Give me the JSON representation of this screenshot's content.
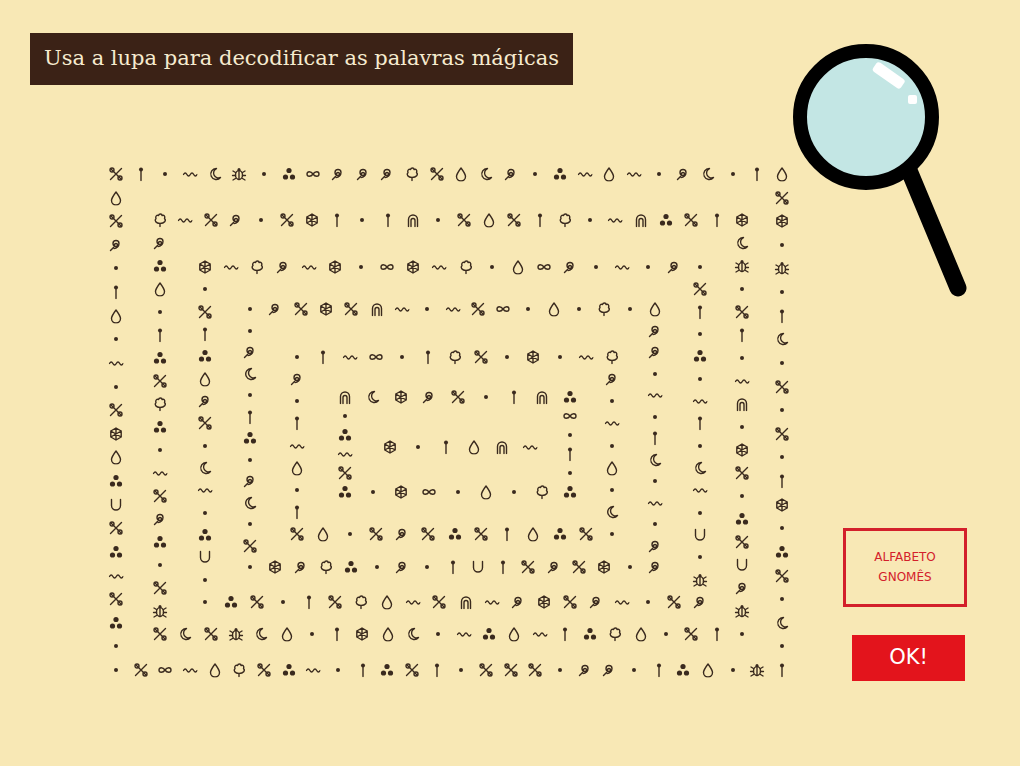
{
  "title": "Usa a lupa para decodificar as palavras mágicas",
  "spiral": {
    "rings": [
      {
        "top": [
          "bow",
          "bar",
          "dot",
          "wave",
          "moon",
          "bug",
          "dot",
          "tri",
          "knot",
          "swirl",
          "swirl",
          "swirl",
          "leaf",
          "bow",
          "drop",
          "moon",
          "swirl",
          "dot",
          "tri",
          "wave",
          "drop",
          "wave",
          "dot",
          "swirl",
          "moon",
          "dot",
          "bar",
          "drop"
        ],
        "right": [
          "bow",
          "hex",
          "dot",
          "bug",
          "dot",
          "bar",
          "moon",
          "dot",
          "bow",
          "dot",
          "bow",
          "dot",
          "bar",
          "hex",
          "dot",
          "tri",
          "bow",
          "dot",
          "moon",
          "dot"
        ],
        "bottom": [
          "dot",
          "bow",
          "knot",
          "wave",
          "drop",
          "leaf",
          "bow",
          "tri",
          "wave",
          "dot",
          "bar",
          "tri",
          "bow",
          "bar",
          "dot",
          "bow",
          "bow",
          "bow",
          "dot",
          "swirl",
          "swirl",
          "dot",
          "bar",
          "tri",
          "drop",
          "dot",
          "bug",
          "bar"
        ],
        "left": [
          "drop",
          "bow",
          "swirl",
          "dot",
          "bar",
          "drop",
          "dot",
          "wave",
          "dot",
          "bow",
          "hex",
          "drop",
          "tri",
          "cup",
          "bow",
          "tri",
          "wave",
          "bow",
          "tri",
          "dot"
        ]
      },
      {
        "top": [
          "leaf",
          "wave",
          "bow",
          "swirl",
          "dot",
          "bow",
          "hex",
          "bar",
          "dot",
          "bar",
          "arch",
          "dot",
          "bow",
          "drop",
          "bow",
          "bar",
          "leaf",
          "dot",
          "wave",
          "arch",
          "tri",
          "bow",
          "bar",
          "hex"
        ],
        "right": [
          "moon",
          "bug",
          "dot",
          "bow",
          "bar",
          "dot",
          "wave",
          "arch",
          "dot",
          "hex",
          "bow",
          "dot",
          "tri",
          "bow",
          "cup",
          "swirl",
          "bug"
        ],
        "bottom": [
          "bow",
          "moon",
          "bow",
          "bug",
          "moon",
          "drop",
          "dot",
          "bar",
          "hex",
          "drop",
          "moon",
          "dot",
          "wave",
          "tri",
          "drop",
          "wave",
          "bar",
          "tri",
          "leaf",
          "drop",
          "dot",
          "bow",
          "bar",
          "dot"
        ],
        "left": [
          "swirl",
          "tri",
          "drop",
          "dot",
          "bar",
          "tri",
          "bow",
          "leaf",
          "tri",
          "dot",
          "wave",
          "bow",
          "swirl",
          "tri",
          "dot",
          "bow",
          "bug"
        ]
      },
      {
        "top": [
          "hex",
          "wave",
          "leaf",
          "swirl",
          "wave",
          "hex",
          "dot",
          "knot",
          "hex",
          "wave",
          "leaf",
          "dot",
          "drop",
          "knot",
          "swirl",
          "dot",
          "wave",
          "dot",
          "swirl",
          "dot"
        ],
        "right": [
          "bow",
          "bar",
          "dot",
          "tri",
          "dot",
          "wave",
          "bar",
          "dot",
          "moon",
          "wave",
          "dot",
          "cup",
          "dot",
          "bug"
        ],
        "bottom": [
          "dot",
          "tri",
          "bow",
          "dot",
          "bar",
          "bow",
          "leaf",
          "drop",
          "wave",
          "bow",
          "arch",
          "wave",
          "swirl",
          "hex",
          "bow",
          "swirl",
          "wave",
          "dot",
          "bow",
          "swirl"
        ],
        "left": [
          "dot",
          "bow",
          "bar",
          "tri",
          "drop",
          "swirl",
          "bow",
          "dot",
          "moon",
          "wave",
          "dot",
          "tri",
          "cup",
          "dot"
        ]
      },
      {
        "top": [
          "dot",
          "swirl",
          "bow",
          "hex",
          "bow",
          "arch",
          "wave",
          "dot",
          "wave",
          "bow",
          "knot",
          "dot",
          "drop",
          "dot",
          "leaf",
          "dot",
          "drop"
        ],
        "right": [
          "swirl",
          "swirl",
          "dot",
          "wave",
          "dot",
          "bar",
          "moon",
          "dot",
          "wave",
          "dot",
          "swirl"
        ],
        "bottom": [
          "dot",
          "hex",
          "swirl",
          "leaf",
          "tri",
          "dot",
          "swirl",
          "dot",
          "bar",
          "cup",
          "bar",
          "bow",
          "swirl",
          "bow",
          "hex",
          "dot",
          "swirl"
        ],
        "left": [
          "dot",
          "swirl",
          "moon",
          "dot",
          "bar",
          "tri",
          "dot",
          "swirl",
          "moon",
          "dot",
          "bow"
        ]
      },
      {
        "top": [
          "dot",
          "bar",
          "wave",
          "knot",
          "dot",
          "bar",
          "leaf",
          "bow",
          "dot",
          "hex",
          "dot",
          "wave",
          "leaf"
        ],
        "right": [
          "swirl",
          "dot",
          "wave",
          "dot",
          "drop",
          "dot",
          "moon"
        ],
        "bottom": [
          "bow",
          "drop",
          "dot",
          "bow",
          "swirl",
          "bow",
          "tri",
          "bow",
          "bar",
          "drop",
          "tri",
          "bow",
          "dot"
        ],
        "left": [
          "swirl",
          "dot",
          "bar",
          "wave",
          "drop",
          "dot",
          "bar"
        ]
      },
      {
        "top": [
          "arch",
          "moon",
          "hex",
          "swirl",
          "bow",
          "dot",
          "bar",
          "arch",
          "tri"
        ],
        "right": [
          "knot",
          "dot",
          "bar",
          "dot"
        ],
        "bottom": [
          "tri",
          "dot",
          "hex",
          "knot",
          "dot",
          "drop",
          "dot",
          "leaf",
          "tri"
        ],
        "left": [
          "dot",
          "tri",
          "wave",
          "bow"
        ]
      },
      {
        "top": [
          "hex",
          "dot",
          "bar",
          "drop",
          "arch",
          "wave"
        ],
        "right": [],
        "bottom": [],
        "left": []
      }
    ]
  },
  "buttons": [
    {
      "label": "ALFABETO GNOMÊS",
      "kind": "outline"
    },
    {
      "label": "OK!",
      "kind": "solid"
    }
  ]
}
